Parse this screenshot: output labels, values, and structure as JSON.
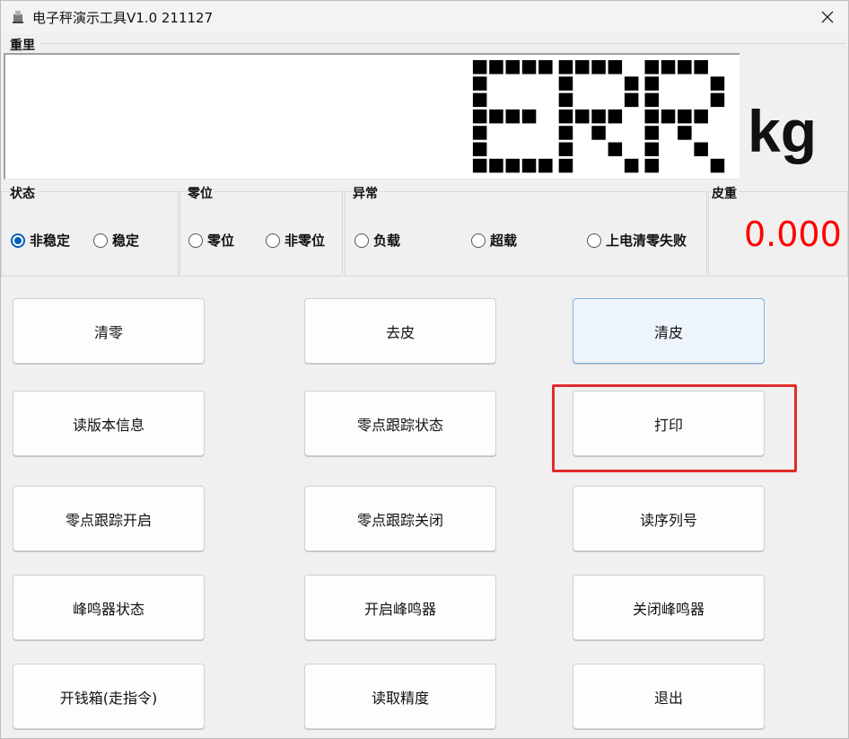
{
  "window": {
    "title": "电子秤演示工具V1.0 211127"
  },
  "weight": {
    "group_label": "重里",
    "display_text": "ERR",
    "unit": "kg"
  },
  "status_group": {
    "label": "状态",
    "options": [
      "非稳定",
      "稳定"
    ],
    "selected": "非稳定"
  },
  "zero_group": {
    "label": "零位",
    "options": [
      "零位",
      "非零位"
    ]
  },
  "abnormal_group": {
    "label": "异常",
    "options": [
      "负载",
      "超载",
      "上电清零失败"
    ]
  },
  "tare_group": {
    "label": "皮重",
    "value": "0.000"
  },
  "buttons": {
    "clear_zero": "清零",
    "tare": "去皮",
    "clear_tare": "清皮",
    "read_version": "读版本信息",
    "zero_track_status": "零点跟踪状态",
    "print": "打印",
    "zero_track_on": "零点跟踪开启",
    "zero_track_off": "零点跟踪关闭",
    "read_serial": "读序列号",
    "buzzer_status": "峰鸣器状态",
    "buzzer_on": "开启峰鸣器",
    "buzzer_off": "关闭峰鸣器",
    "open_drawer": "开钱箱(走指令)",
    "read_precision": "读取精度",
    "exit": "退出"
  },
  "colors": {
    "tare_value": "#ff0000",
    "radio_checked": "#005fb8",
    "highlight": "#e12b2b",
    "dot_matrix": "#000000"
  }
}
